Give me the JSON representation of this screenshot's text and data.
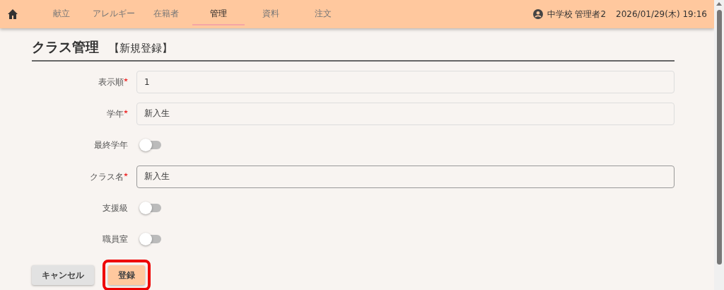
{
  "navbar": {
    "tabs": [
      {
        "label": "献立",
        "selected": false
      },
      {
        "label": "アレルギー",
        "selected": false
      },
      {
        "label": "在籍者",
        "selected": false
      },
      {
        "label": "管理",
        "selected": true
      },
      {
        "label": "資料",
        "selected": false
      },
      {
        "label": "注文",
        "selected": false
      }
    ],
    "user": "中学校 管理者2",
    "datetime": "2026/01/29(木) 19:16"
  },
  "page": {
    "title": "クラス管理",
    "subtitle": "【新規登録】"
  },
  "form": [
    {
      "kind": "text",
      "label": "表示順",
      "required": true,
      "value": "1",
      "focused": false
    },
    {
      "kind": "text",
      "label": "学年",
      "required": true,
      "value": "新入生",
      "focused": false
    },
    {
      "kind": "switch",
      "label": "最終学年",
      "required": false,
      "on": false
    },
    {
      "kind": "text",
      "label": "クラス名",
      "required": true,
      "value": "新入生",
      "focused": true
    },
    {
      "kind": "switch",
      "label": "支援級",
      "required": false,
      "on": false
    },
    {
      "kind": "switch",
      "label": "職員室",
      "required": false,
      "on": false
    }
  ],
  "buttons": [
    {
      "label": "キャンセル",
      "kind": "secondary",
      "highlighted": false
    },
    {
      "label": "登録",
      "kind": "primary",
      "highlighted": true
    }
  ]
}
